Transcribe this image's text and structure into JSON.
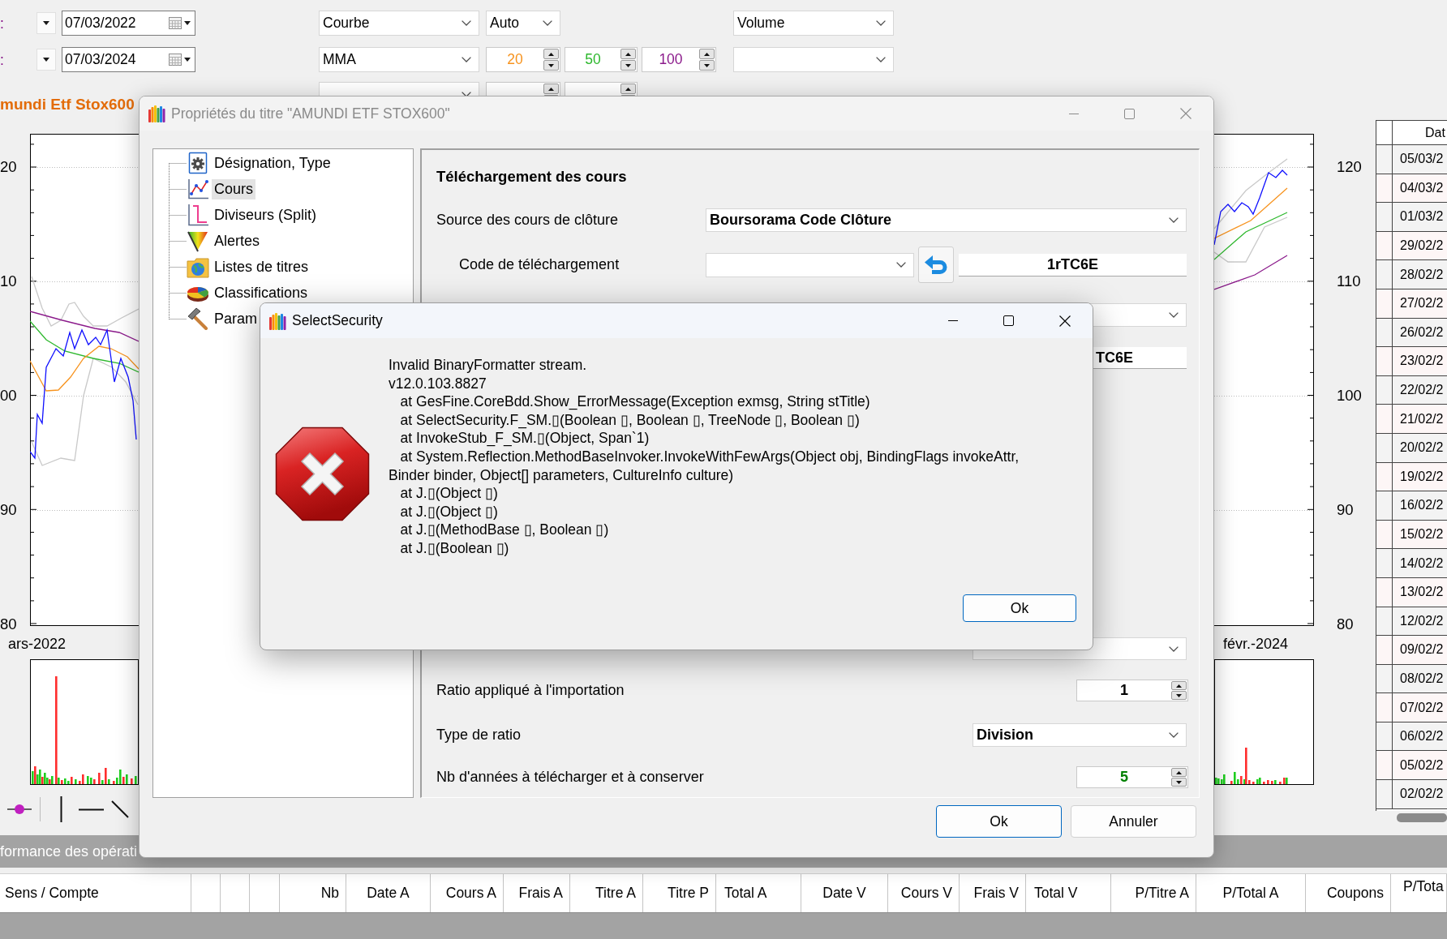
{
  "date_range": [
    {
      "label": ":",
      "date": "07/03/2022"
    },
    {
      "label": ":",
      "date": "07/03/2024"
    }
  ],
  "chart_settings": [
    {
      "indicator": {
        "kind": "dropdown",
        "value": "Courbe"
      },
      "params": [
        {
          "kind": "dropdown",
          "value": "Auto"
        }
      ],
      "lower_panel": {
        "kind": "dropdown",
        "value": "Volume"
      }
    },
    {
      "indicator": {
        "kind": "dropdown",
        "value": "MMA"
      },
      "params": [
        {
          "kind": "spinner",
          "value": "20",
          "color": "#f7931e"
        },
        {
          "kind": "spinner",
          "value": "50",
          "color": "#2db82d"
        },
        {
          "kind": "spinner",
          "value": "100",
          "color": "#8b1a8b"
        }
      ],
      "lower_panel": {
        "kind": "dropdown"
      }
    },
    {
      "indicator": {
        "kind": "dropdown"
      },
      "params": [
        {
          "kind": "spinner"
        },
        {
          "kind": "spinner"
        }
      ]
    }
  ],
  "security_name": "mundi Etf Stox600",
  "price_chart": {
    "left_axis_labels": [
      "20",
      "10",
      "00",
      "90",
      "80"
    ],
    "left_date_label": "ars-2022",
    "right_axis_labels": [
      "120",
      "110",
      "100",
      "90",
      "80"
    ],
    "right_date_label": "févr.-2024"
  },
  "price_table": {
    "header": "Dat",
    "rows": [
      "05/03/2",
      "04/03/2",
      "01/03/2",
      "29/02/2",
      "28/02/2",
      "27/02/2",
      "26/02/2",
      "23/02/2",
      "22/02/2",
      "21/02/2",
      "20/02/2",
      "19/02/2",
      "16/02/2",
      "15/02/2",
      "14/02/2",
      "13/02/2",
      "12/02/2",
      "09/02/2",
      "08/02/2",
      "07/02/2",
      "06/02/2",
      "05/02/2",
      "02/02/2"
    ]
  },
  "operations": {
    "title": "formance des opérati",
    "columns": [
      {
        "kind": "text",
        "label": "Sens / Compte"
      },
      {
        "kind": "blank"
      },
      {
        "kind": "blank"
      },
      {
        "kind": "blank"
      },
      {
        "kind": "text",
        "label": "Nb"
      },
      {
        "kind": "text",
        "label": "Date A"
      },
      {
        "kind": "text",
        "label": "Cours A"
      },
      {
        "kind": "text",
        "label": "Frais A"
      },
      {
        "kind": "text",
        "label": "Titre A"
      },
      {
        "kind": "text",
        "label": "Titre P"
      },
      {
        "kind": "text",
        "label": "Total A"
      },
      {
        "kind": "text",
        "label": "Date V"
      },
      {
        "kind": "text",
        "label": "Cours V"
      },
      {
        "kind": "text",
        "label": "Frais V"
      },
      {
        "kind": "text",
        "label": "Total V"
      },
      {
        "kind": "text",
        "label": "P/Titre A"
      },
      {
        "kind": "text",
        "label": "P/Total A"
      },
      {
        "kind": "text",
        "label": "Coupons"
      },
      {
        "kind": "text",
        "label": "P/Tota"
      }
    ]
  },
  "properties_dialog": {
    "title": "Propriétés du titre \"AMUNDI ETF STOX600\"",
    "active": false,
    "tree": [
      {
        "label": "Désignation, Type",
        "selected": false
      },
      {
        "label": "Cours",
        "selected": true
      },
      {
        "label": "Diviseurs (Split)",
        "selected": false
      },
      {
        "label": "Alertes",
        "selected": false
      },
      {
        "label": "Listes de titres",
        "selected": false
      },
      {
        "label": "Classifications",
        "selected": false
      },
      {
        "label": "Param",
        "selected": false
      }
    ],
    "section_title": "Téléchargement des cours",
    "fields": [
      {
        "kind": "dropdown",
        "label": "Source des cours de clôture",
        "value": "Boursorama Code Clôture"
      },
      {
        "kind": "code",
        "label": "Code de téléchargement",
        "value": "1rTC6E"
      },
      {
        "kind": "dropdown"
      },
      {
        "kind": "text",
        "value": "TC6E"
      },
      {
        "kind": "dropdown"
      },
      {
        "kind": "spinner",
        "label": "Ratio appliqué à l'importation",
        "value": "1"
      },
      {
        "kind": "dropdown",
        "label": "Type de ratio",
        "value": "Division"
      },
      {
        "kind": "spinner",
        "label": "Nb d'années à télécharger et à conserver",
        "value": "5",
        "color": "#008000"
      }
    ],
    "buttons": [
      {
        "label": "Ok",
        "default": true
      },
      {
        "label": "Annuler",
        "default": false
      }
    ]
  },
  "error_dialog": {
    "title": "SelectSecurity",
    "active": true,
    "message": "Invalid BinaryFormatter stream.\nv12.0.103.8827\n   at GesFine.CoreBdd.Show_ErrorMessage(Exception exmsg, String stTitle)\n   at SelectSecurity.F_SM.▯(Boolean ▯, Boolean ▯, TreeNode ▯, Boolean ▯)\n   at InvokeStub_F_SM.▯(Object, Span`1)\n   at System.Reflection.MethodBaseInvoker.InvokeWithFewArgs(Object obj, BindingFlags invokeAttr,\nBinder binder, Object[] parameters, CultureInfo culture)\n   at J.▯(Object ▯)\n   at J.▯(Object ▯)\n   at J.▯(MethodBase ▯, Boolean ▯)\n   at J.▯(Boolean ▯)",
    "buttons": [
      {
        "label": "Ok",
        "default": true
      }
    ]
  }
}
